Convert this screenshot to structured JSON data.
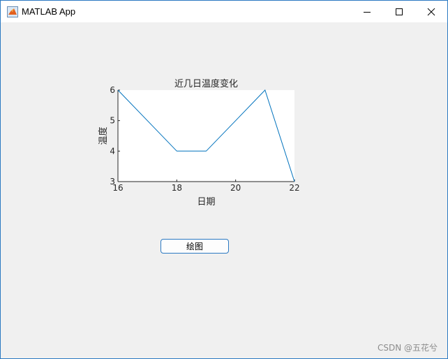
{
  "window": {
    "title": "MATLAB App",
    "icons": {
      "app": "matlab-membrane-icon",
      "minimize": "minimize-icon",
      "maximize": "maximize-icon",
      "close": "close-icon"
    }
  },
  "chart_data": {
    "type": "line",
    "title": "近几日温度变化",
    "xlabel": "日期",
    "ylabel": "温度",
    "x": [
      16,
      17,
      18,
      19,
      20,
      21,
      22
    ],
    "series": [
      {
        "values": [
          6,
          5,
          4,
          4,
          5,
          6,
          3
        ],
        "color": "#0072bd"
      }
    ],
    "xlim": [
      16,
      22
    ],
    "ylim": [
      3,
      6
    ],
    "xticks": [
      16,
      18,
      20,
      22
    ],
    "yticks": [
      3,
      4,
      5,
      6
    ],
    "grid": false,
    "plot_background": "#ffffff"
  },
  "plot_button": {
    "label": "绘图"
  },
  "watermark": "CSDN @五花兮"
}
